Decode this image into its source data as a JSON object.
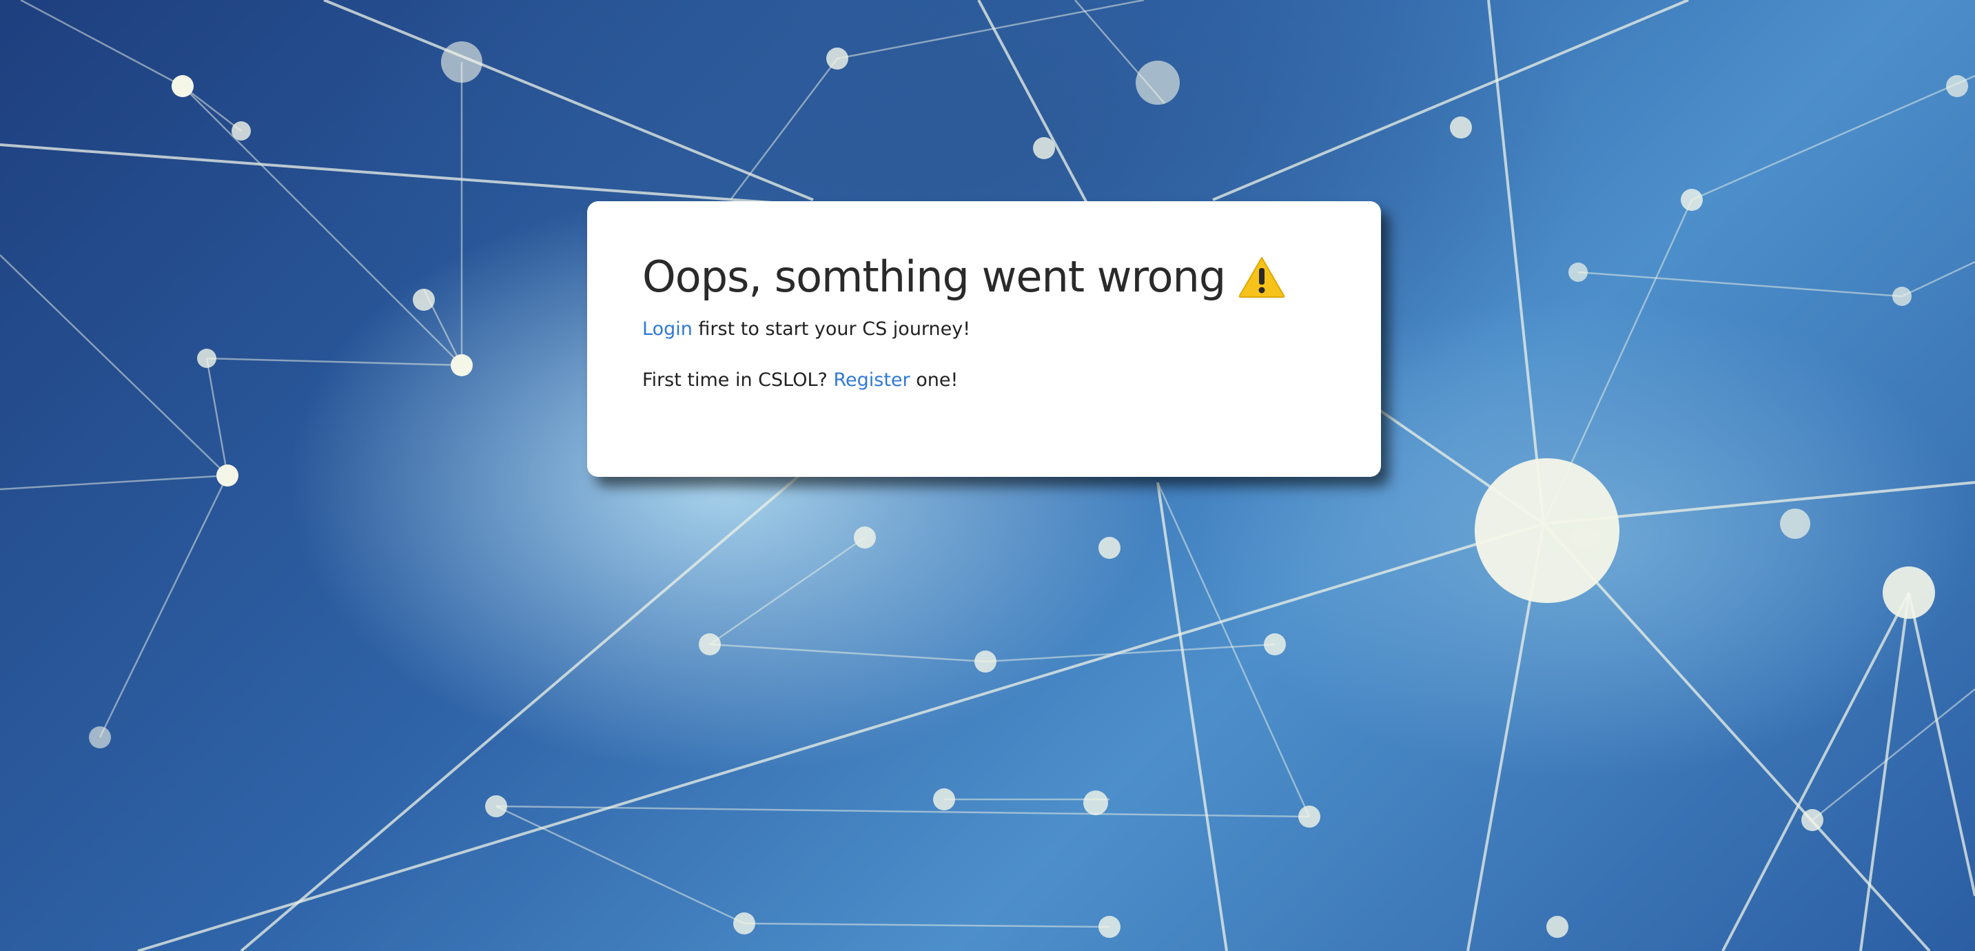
{
  "error": {
    "title": "Oops, somthing went wrong",
    "icon": "warning-icon",
    "login_link": "Login",
    "login_suffix": " first to start your CS journey!",
    "register_prefix": "First time in CSLOL? ",
    "register_link": "Register",
    "register_suffix": " one!"
  },
  "colors": {
    "link": "#2f7ad6",
    "warning": "#f7c31b",
    "background": "#2f64a8"
  }
}
